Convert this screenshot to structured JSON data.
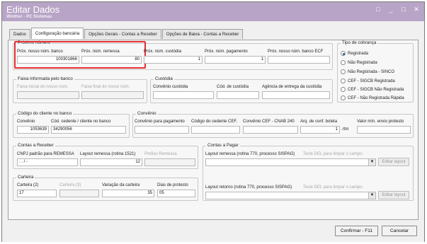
{
  "window": {
    "title": "Editar Dados",
    "subtitle": "Winthor - PC Sistemas",
    "restore_label": "□",
    "minimize_label": "_",
    "maximize_label": "□",
    "close_label": "✕"
  },
  "tabs": [
    {
      "label": "Dados"
    },
    {
      "label": "Configuração bancária"
    },
    {
      "label": "Opções Gerais - Contas a Receber"
    },
    {
      "label": "Opções de Baixa - Contas a Receber"
    }
  ],
  "proximo_numero": {
    "title": "Próximo número",
    "nosso_num_banco_label": "Próx. nosso núm. banco",
    "nosso_num_banco_value": "100301866",
    "num_remessa_label": "Próx. núm. remessa",
    "num_remessa_value": "80",
    "num_custodia_label": "Próx. núm. custódia",
    "num_custodia_value": "1",
    "num_pagamento_label": "Próx. núm. pagamento",
    "num_pagamento_value": "1",
    "nosso_num_ecf_label": "Próx. nosso núm. banco ECF",
    "nosso_num_ecf_value": ""
  },
  "tipo_cobranca": {
    "title": "Tipo de cobrança",
    "options": [
      {
        "label": "Registrada",
        "selected": true
      },
      {
        "label": "Não Registrada",
        "selected": false
      },
      {
        "label": "Não Registrada - SINCO",
        "selected": false
      },
      {
        "label": "CEF - SIGCB Registrada",
        "selected": false
      },
      {
        "label": "CEF - SIGCB Não Registrada",
        "selected": false
      },
      {
        "label": "CEF - Não Registrada Rápida",
        "selected": false
      }
    ]
  },
  "faixa": {
    "title": "Faixa informada pelo banco",
    "inicial_label": "Faixa inicial do nosso núm.",
    "final_label": "Faixa final do nosso núm."
  },
  "custodia": {
    "title": "Custódia",
    "convenio_label": "Convênio custódia",
    "codigo_label": "Cód. de custódia",
    "agencia_label": "Agência de entrega da custódia"
  },
  "codigo_cliente": {
    "title": "Código do cliente no banco",
    "convenio_label": "Convênio",
    "convenio_value": "1053639",
    "cedente_label": "Cód. cedente / cliente no banco",
    "cedente_value": "34290056"
  },
  "convenio": {
    "title": "Convênio",
    "pagamento_label": "Convênio para pagamento",
    "cedente_cef_label": "Código do cedente CEF.",
    "cnab_label": "Convênio CEF - CNAB 240",
    "arq_boleta_label": "Arq. de conf. boleta",
    "arq_boleta_value": "1",
    "arq_boleta_ext": ".rtm",
    "valor_min_label": "Valor mín. envio protesto"
  },
  "contas_receber": {
    "title": "Contas a Receber",
    "cnpj_label": "CNPJ padrão para REMESSA",
    "cnpj_value": ". . / -",
    "layout_label": "Layout remessa (rotina 1521)",
    "layout_value": "12",
    "prefixo_label": "Prefixo Remessa"
  },
  "carteira": {
    "title": "Carteira",
    "carteira2_label": "Carteira (2)",
    "carteira2_value": "17",
    "carteira3_label": "Carteira (3)",
    "variacao_label": "Variação da carteira",
    "variacao_value": "35",
    "dias_label": "Dias de protesto",
    "dias_value": "05"
  },
  "contas_pagar": {
    "title": "Contas a Pagar",
    "remessa_label": "Layout remessa (rotina 770, processo SISPAG)",
    "remessa_hint": "Tecle DEL para limpar o campo.",
    "retorno_label": "Layout retorno (rotina 770, processo SISPAG)",
    "retorno_hint": "Tecle DEL para limpar o campo.",
    "editar_label": "Editar layout"
  },
  "footer": {
    "confirm_label": "Confirmar - F11",
    "cancel_label": "Cancelar"
  },
  "colors": {
    "titlebar": "#b7a4c6",
    "highlight": "#e53030"
  }
}
